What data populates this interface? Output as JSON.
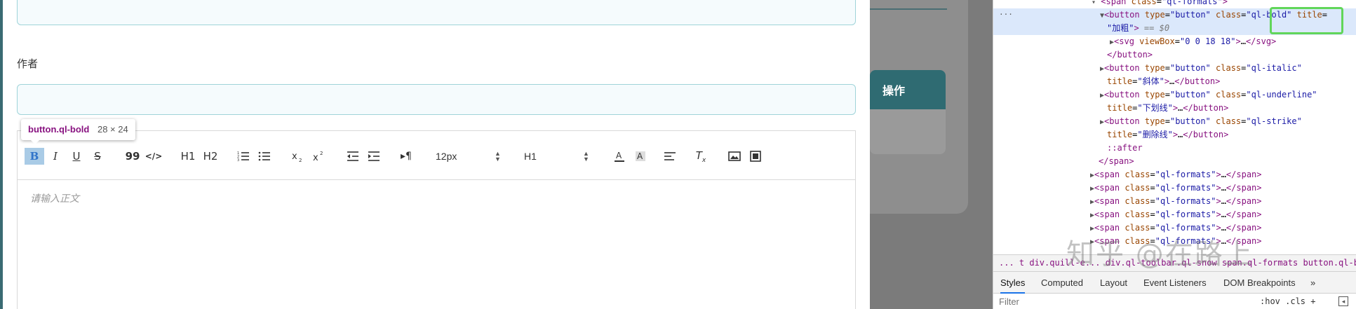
{
  "form": {
    "author_label": "作者",
    "tooltip": {
      "tag": "button.ql-bold",
      "size": "28 × 24"
    },
    "toolbar": {
      "bold": "B",
      "italic": "I",
      "underline": "U",
      "strike": "S",
      "blockquote": "99",
      "code": "</>",
      "h1": "H1",
      "h2": "H2",
      "size_value": "12px",
      "header_value": "H1"
    },
    "editor_placeholder": "请输入正文"
  },
  "background": {
    "action_header": "操作"
  },
  "devtools": {
    "lines": [
      {
        "indent": 0,
        "prefix": "  ▼",
        "code": "<span class=\"ql-formats\">"
      },
      {
        "indent": 1,
        "code": "<button type=\"button\" class=\"ql-bold\" title="
      },
      {
        "indent": 1,
        "code": "\"加粗\"> == $0"
      },
      {
        "indent": 2,
        "code": "<svg viewBox=\"0 0 18 18\">…</svg>"
      },
      {
        "indent": 1,
        "code": "</button>"
      },
      {
        "indent": 1,
        "code": "<button type=\"button\" class=\"ql-italic\""
      },
      {
        "indent": 1,
        "code": "title=\"斜体\">…</button>"
      },
      {
        "indent": 1,
        "code": "<button type=\"button\" class=\"ql-underline\""
      },
      {
        "indent": 1,
        "code": "title=\"下划线\">…</button>"
      },
      {
        "indent": 1,
        "code": "<button type=\"button\" class=\"ql-strike\""
      },
      {
        "indent": 1,
        "code": "title=\"删除线\">…</button>"
      },
      {
        "indent": 1,
        "code": "::after"
      },
      {
        "indent": 0,
        "code": "</span>"
      },
      {
        "indent": 0,
        "code": "<span class=\"ql-formats\">…</span>"
      },
      {
        "indent": 0,
        "code": "<span class=\"ql-formats\">…</span>"
      },
      {
        "indent": 0,
        "code": "<span class=\"ql-formats\">…</span>"
      },
      {
        "indent": 0,
        "code": "<span class=\"ql-formats\">…</span>"
      },
      {
        "indent": 0,
        "code": "<span class=\"ql-formats\">…</span>"
      },
      {
        "indent": 0,
        "code": "<span class=\"ql-formats\">…</span>"
      }
    ],
    "breadcrumb": "...  t   div.quill-e...   div.ql-toolbar.ql-snow   span.ql-formats   button.ql-bold",
    "tabs": [
      "Styles",
      "Computed",
      "Layout",
      "Event Listeners",
      "DOM Breakpoints",
      "»"
    ],
    "filter_placeholder": "Filter",
    "filter_right": ":hov  .cls  +"
  },
  "watermark": "知乎 @在路上"
}
